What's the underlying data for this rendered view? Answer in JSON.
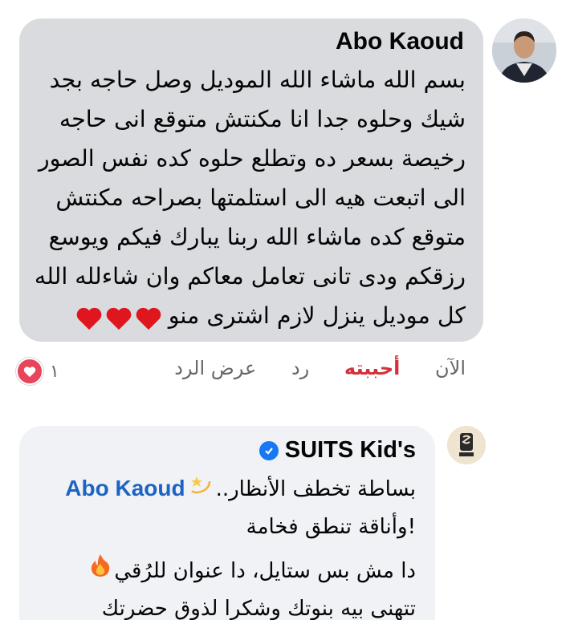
{
  "comment1": {
    "author": "Abo Kaoud",
    "body_lines": [
      "بسم الله ماشاء الله الموديل وصل حاجه بجد",
      "شيك وحلوه جدا انا مكنتش متوقع انى حاجه",
      "رخيصة بسعر ده وتطلع حلوه كده نفس الصور",
      "الى اتبعت هيه الى استلمتها بصراحه مكنتش",
      "متوقع كده ماشاء الله ربنا يبارك فيكم ويوسع",
      "رزقكم ودى تانى تعامل معاكم وان شاءلله الله",
      "كل موديل ينزل لازم اشترى منو"
    ],
    "trailing_emoji": "heart-emoji x3",
    "actions": {
      "time": "الآن",
      "like": "أحببته",
      "reply": "رد",
      "view_replies": "عرض الرد"
    },
    "reaction_count": "١",
    "reaction_icon": "heart-reaction-icon"
  },
  "comment2": {
    "author": "SUITS Kid's",
    "verified_icon": "verified-badge-icon",
    "mention": "Abo Kaoud",
    "line1_text": "بساطة تخطف الأنظار..",
    "line2_text": "!وأناقة تنطق فخامة",
    "line3_text": "دا مش بس ستايل، دا عنوان للرُقي",
    "line4_text": "تتهنى بيه بنوتك  وشكرا لذوق حضرتك"
  },
  "colors": {
    "bubble_gray": "#d9dbdf",
    "bubble_light": "#f0f2f5",
    "liked_red": "#d3323b",
    "mention_blue": "#1c64c4",
    "verified_blue": "#1877f2",
    "meta_gray": "#65676b"
  }
}
